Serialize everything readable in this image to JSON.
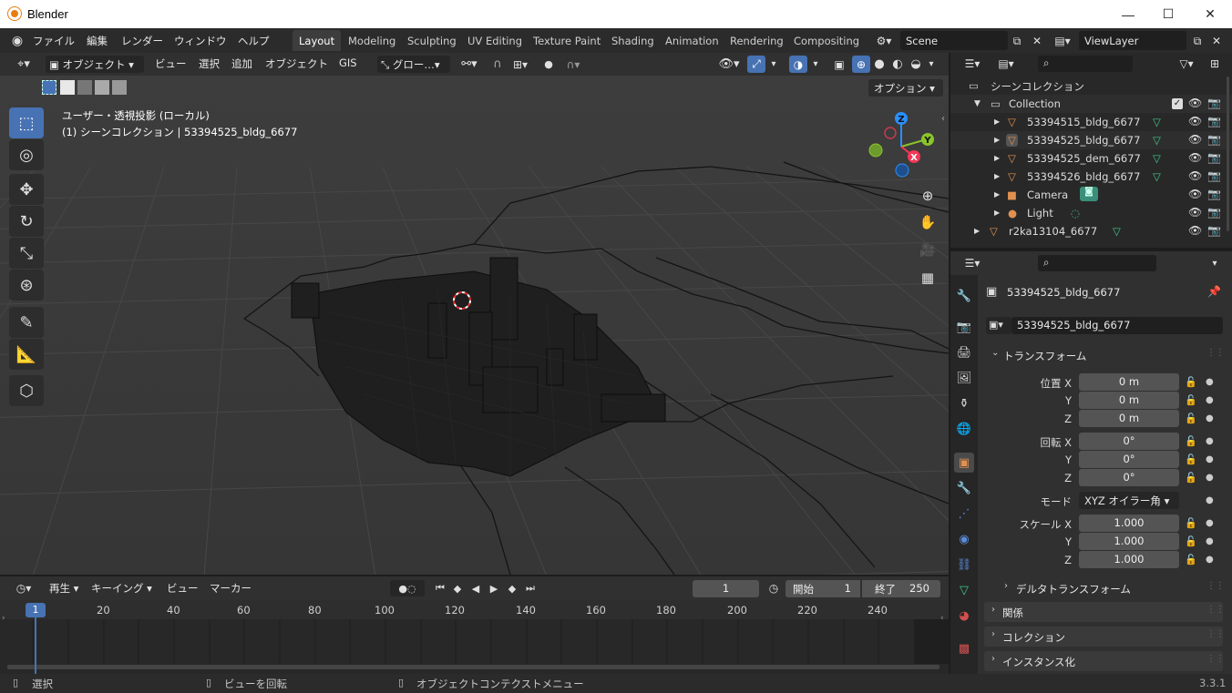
{
  "window": {
    "title": "Blender",
    "minimize": "—",
    "maximize": "☐",
    "close": "✕"
  },
  "menu": [
    "ファイル",
    "編集",
    "レンダー",
    "ウィンドウ",
    "ヘルプ"
  ],
  "workspaces": [
    "Layout",
    "Modeling",
    "Sculpting",
    "UV Editing",
    "Texture Paint",
    "Shading",
    "Animation",
    "Rendering",
    "Compositing"
  ],
  "scene": {
    "scene_name": "Scene",
    "view_layer": "ViewLayer"
  },
  "viewport_header": {
    "mode": "オブジェクト",
    "items": [
      "ビュー",
      "選択",
      "追加",
      "オブジェクト",
      "GIS"
    ],
    "transform_orientation": "グロー…",
    "options": "オプション"
  },
  "viewport": {
    "overlay_line1": "ユーザー・透視投影 (ローカル)",
    "overlay_line2": "(1) シーンコレクション | 53394525_bldg_6677",
    "gizmo": {
      "z": "Z",
      "y": "Y",
      "x": "X"
    }
  },
  "outliner": {
    "root": "シーンコレクション",
    "collection": "Collection",
    "items": [
      {
        "name": "53394515_bldg_6677",
        "icon": "mesh-icon"
      },
      {
        "name": "53394525_bldg_6677",
        "icon": "mesh-icon"
      },
      {
        "name": "53394525_dem_6677",
        "icon": "mesh-icon"
      },
      {
        "name": "53394526_bldg_6677",
        "icon": "mesh-icon"
      },
      {
        "name": "Camera",
        "icon": "camera-icon"
      },
      {
        "name": "Light",
        "icon": "light-icon"
      }
    ],
    "extra": "r2ka13104_6677"
  },
  "properties": {
    "object_name": "53394525_bldg_6677",
    "datablock": "53394525_bldg_6677",
    "transform_section": "トランスフォーム",
    "location": {
      "label_x": "位置 X",
      "label_y": "Y",
      "label_z": "Z",
      "x": "0 m",
      "y": "0 m",
      "z": "0 m"
    },
    "rotation": {
      "label_x": "回転 X",
      "label_y": "Y",
      "label_z": "Z",
      "x": "0°",
      "y": "0°",
      "z": "0°"
    },
    "mode_label": "モード",
    "mode_value": "XYZ オイラー角",
    "scale": {
      "label_x": "スケール X",
      "label_y": "Y",
      "label_z": "Z",
      "x": "1.000",
      "y": "1.000",
      "z": "1.000"
    },
    "delta": "デルタトランスフォーム",
    "sections": [
      "関係",
      "コレクション",
      "インスタンス化"
    ]
  },
  "timeline": {
    "menu": [
      "再生",
      "キーイング",
      "ビュー",
      "マーカー"
    ],
    "current_frame": "1",
    "start_label": "開始",
    "start": "1",
    "end_label": "終了",
    "end": "250",
    "ticks": [
      "1",
      "20",
      "40",
      "60",
      "80",
      "100",
      "120",
      "140",
      "160",
      "180",
      "200",
      "220",
      "240"
    ]
  },
  "status": {
    "select": "選択",
    "rotate": "ビューを回転",
    "context": "オブジェクトコンテクストメニュー",
    "version": "3.3.1"
  },
  "colors": {
    "accent": "#4772b3",
    "active_obj": "#e09050",
    "gizmo_x": "#f53657",
    "gizmo_y": "#8bc42a",
    "gizmo_z": "#2c8fff"
  }
}
